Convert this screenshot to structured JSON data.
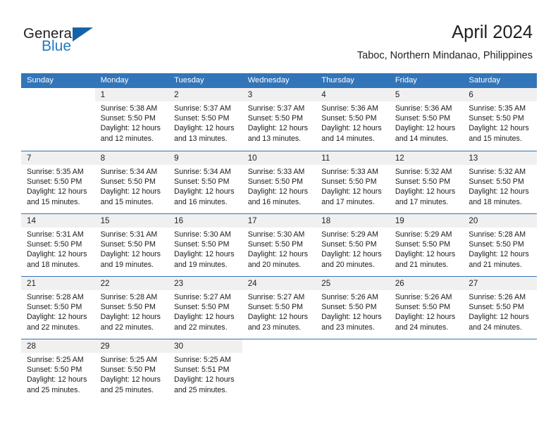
{
  "brand": {
    "name_part1": "General",
    "name_part2": "Blue",
    "triangle_color": "#1463a8",
    "blue_text_color": "#1f7ac4"
  },
  "header": {
    "title": "April 2024",
    "subtitle": "Taboc, Northern Mindanao, Philippines"
  },
  "theme": {
    "header_row_bg": "#3275b8",
    "daynum_bg": "#f0f0f0",
    "week_divider": "#3275b8",
    "page_bg": "#ffffff"
  },
  "labels": {
    "sunrise_prefix": "Sunrise:",
    "sunset_prefix": "Sunset:",
    "daylight_prefix": "Daylight:"
  },
  "weekdays": [
    "Sunday",
    "Monday",
    "Tuesday",
    "Wednesday",
    "Thursday",
    "Friday",
    "Saturday"
  ],
  "weeks": [
    [
      {
        "empty": true
      },
      {
        "day": "1",
        "sunrise": "Sunrise: 5:38 AM",
        "sunset": "Sunset: 5:50 PM",
        "daylight_l1": "Daylight: 12 hours",
        "daylight_l2": "and 12 minutes."
      },
      {
        "day": "2",
        "sunrise": "Sunrise: 5:37 AM",
        "sunset": "Sunset: 5:50 PM",
        "daylight_l1": "Daylight: 12 hours",
        "daylight_l2": "and 13 minutes."
      },
      {
        "day": "3",
        "sunrise": "Sunrise: 5:37 AM",
        "sunset": "Sunset: 5:50 PM",
        "daylight_l1": "Daylight: 12 hours",
        "daylight_l2": "and 13 minutes."
      },
      {
        "day": "4",
        "sunrise": "Sunrise: 5:36 AM",
        "sunset": "Sunset: 5:50 PM",
        "daylight_l1": "Daylight: 12 hours",
        "daylight_l2": "and 14 minutes."
      },
      {
        "day": "5",
        "sunrise": "Sunrise: 5:36 AM",
        "sunset": "Sunset: 5:50 PM",
        "daylight_l1": "Daylight: 12 hours",
        "daylight_l2": "and 14 minutes."
      },
      {
        "day": "6",
        "sunrise": "Sunrise: 5:35 AM",
        "sunset": "Sunset: 5:50 PM",
        "daylight_l1": "Daylight: 12 hours",
        "daylight_l2": "and 15 minutes."
      }
    ],
    [
      {
        "day": "7",
        "sunrise": "Sunrise: 5:35 AM",
        "sunset": "Sunset: 5:50 PM",
        "daylight_l1": "Daylight: 12 hours",
        "daylight_l2": "and 15 minutes."
      },
      {
        "day": "8",
        "sunrise": "Sunrise: 5:34 AM",
        "sunset": "Sunset: 5:50 PM",
        "daylight_l1": "Daylight: 12 hours",
        "daylight_l2": "and 15 minutes."
      },
      {
        "day": "9",
        "sunrise": "Sunrise: 5:34 AM",
        "sunset": "Sunset: 5:50 PM",
        "daylight_l1": "Daylight: 12 hours",
        "daylight_l2": "and 16 minutes."
      },
      {
        "day": "10",
        "sunrise": "Sunrise: 5:33 AM",
        "sunset": "Sunset: 5:50 PM",
        "daylight_l1": "Daylight: 12 hours",
        "daylight_l2": "and 16 minutes."
      },
      {
        "day": "11",
        "sunrise": "Sunrise: 5:33 AM",
        "sunset": "Sunset: 5:50 PM",
        "daylight_l1": "Daylight: 12 hours",
        "daylight_l2": "and 17 minutes."
      },
      {
        "day": "12",
        "sunrise": "Sunrise: 5:32 AM",
        "sunset": "Sunset: 5:50 PM",
        "daylight_l1": "Daylight: 12 hours",
        "daylight_l2": "and 17 minutes."
      },
      {
        "day": "13",
        "sunrise": "Sunrise: 5:32 AM",
        "sunset": "Sunset: 5:50 PM",
        "daylight_l1": "Daylight: 12 hours",
        "daylight_l2": "and 18 minutes."
      }
    ],
    [
      {
        "day": "14",
        "sunrise": "Sunrise: 5:31 AM",
        "sunset": "Sunset: 5:50 PM",
        "daylight_l1": "Daylight: 12 hours",
        "daylight_l2": "and 18 minutes."
      },
      {
        "day": "15",
        "sunrise": "Sunrise: 5:31 AM",
        "sunset": "Sunset: 5:50 PM",
        "daylight_l1": "Daylight: 12 hours",
        "daylight_l2": "and 19 minutes."
      },
      {
        "day": "16",
        "sunrise": "Sunrise: 5:30 AM",
        "sunset": "Sunset: 5:50 PM",
        "daylight_l1": "Daylight: 12 hours",
        "daylight_l2": "and 19 minutes."
      },
      {
        "day": "17",
        "sunrise": "Sunrise: 5:30 AM",
        "sunset": "Sunset: 5:50 PM",
        "daylight_l1": "Daylight: 12 hours",
        "daylight_l2": "and 20 minutes."
      },
      {
        "day": "18",
        "sunrise": "Sunrise: 5:29 AM",
        "sunset": "Sunset: 5:50 PM",
        "daylight_l1": "Daylight: 12 hours",
        "daylight_l2": "and 20 minutes."
      },
      {
        "day": "19",
        "sunrise": "Sunrise: 5:29 AM",
        "sunset": "Sunset: 5:50 PM",
        "daylight_l1": "Daylight: 12 hours",
        "daylight_l2": "and 21 minutes."
      },
      {
        "day": "20",
        "sunrise": "Sunrise: 5:28 AM",
        "sunset": "Sunset: 5:50 PM",
        "daylight_l1": "Daylight: 12 hours",
        "daylight_l2": "and 21 minutes."
      }
    ],
    [
      {
        "day": "21",
        "sunrise": "Sunrise: 5:28 AM",
        "sunset": "Sunset: 5:50 PM",
        "daylight_l1": "Daylight: 12 hours",
        "daylight_l2": "and 22 minutes."
      },
      {
        "day": "22",
        "sunrise": "Sunrise: 5:28 AM",
        "sunset": "Sunset: 5:50 PM",
        "daylight_l1": "Daylight: 12 hours",
        "daylight_l2": "and 22 minutes."
      },
      {
        "day": "23",
        "sunrise": "Sunrise: 5:27 AM",
        "sunset": "Sunset: 5:50 PM",
        "daylight_l1": "Daylight: 12 hours",
        "daylight_l2": "and 22 minutes."
      },
      {
        "day": "24",
        "sunrise": "Sunrise: 5:27 AM",
        "sunset": "Sunset: 5:50 PM",
        "daylight_l1": "Daylight: 12 hours",
        "daylight_l2": "and 23 minutes."
      },
      {
        "day": "25",
        "sunrise": "Sunrise: 5:26 AM",
        "sunset": "Sunset: 5:50 PM",
        "daylight_l1": "Daylight: 12 hours",
        "daylight_l2": "and 23 minutes."
      },
      {
        "day": "26",
        "sunrise": "Sunrise: 5:26 AM",
        "sunset": "Sunset: 5:50 PM",
        "daylight_l1": "Daylight: 12 hours",
        "daylight_l2": "and 24 minutes."
      },
      {
        "day": "27",
        "sunrise": "Sunrise: 5:26 AM",
        "sunset": "Sunset: 5:50 PM",
        "daylight_l1": "Daylight: 12 hours",
        "daylight_l2": "and 24 minutes."
      }
    ],
    [
      {
        "day": "28",
        "sunrise": "Sunrise: 5:25 AM",
        "sunset": "Sunset: 5:50 PM",
        "daylight_l1": "Daylight: 12 hours",
        "daylight_l2": "and 25 minutes."
      },
      {
        "day": "29",
        "sunrise": "Sunrise: 5:25 AM",
        "sunset": "Sunset: 5:50 PM",
        "daylight_l1": "Daylight: 12 hours",
        "daylight_l2": "and 25 minutes."
      },
      {
        "day": "30",
        "sunrise": "Sunrise: 5:25 AM",
        "sunset": "Sunset: 5:51 PM",
        "daylight_l1": "Daylight: 12 hours",
        "daylight_l2": "and 25 minutes."
      },
      {
        "empty": true
      },
      {
        "empty": true
      },
      {
        "empty": true
      },
      {
        "empty": true
      }
    ]
  ]
}
